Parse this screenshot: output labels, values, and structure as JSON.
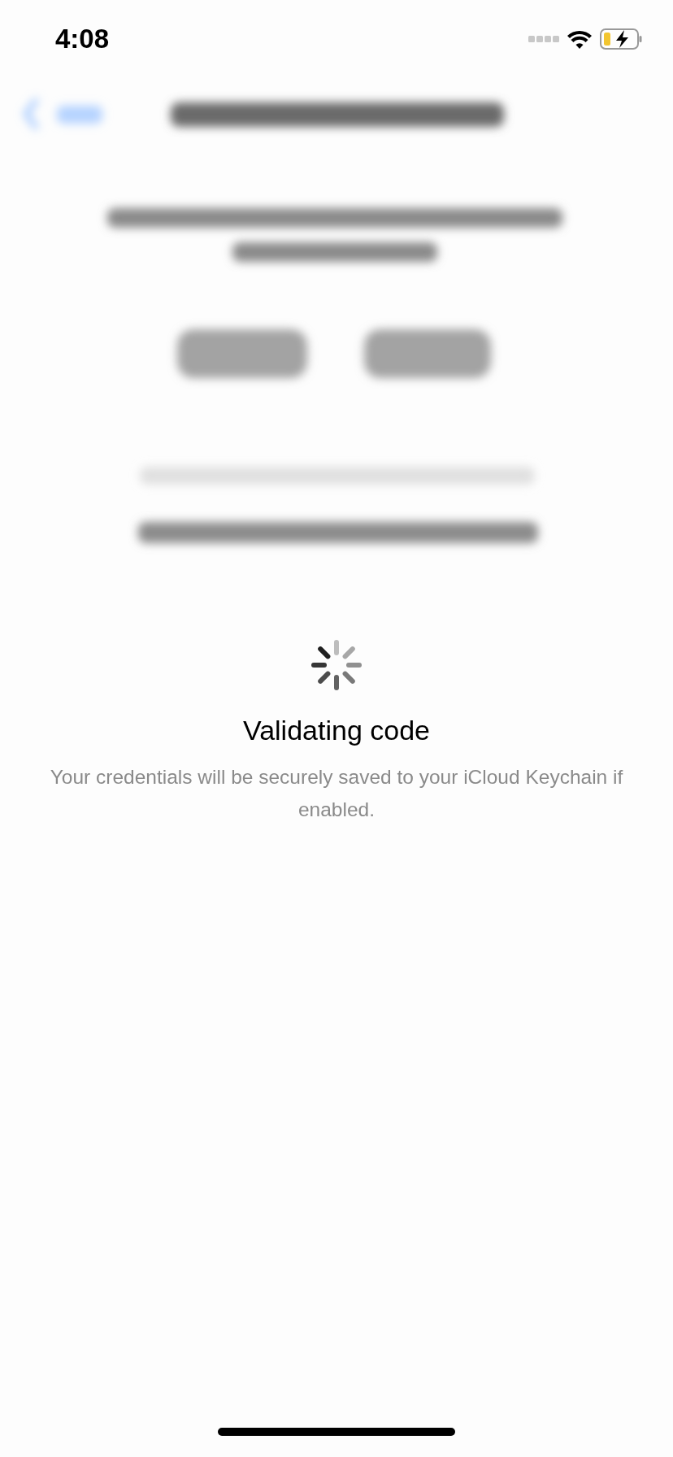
{
  "status_bar": {
    "time": "4:08"
  },
  "overlay": {
    "title": "Validating code",
    "message": "Your credentials will be securely saved to your iCloud Keychain if enabled."
  }
}
